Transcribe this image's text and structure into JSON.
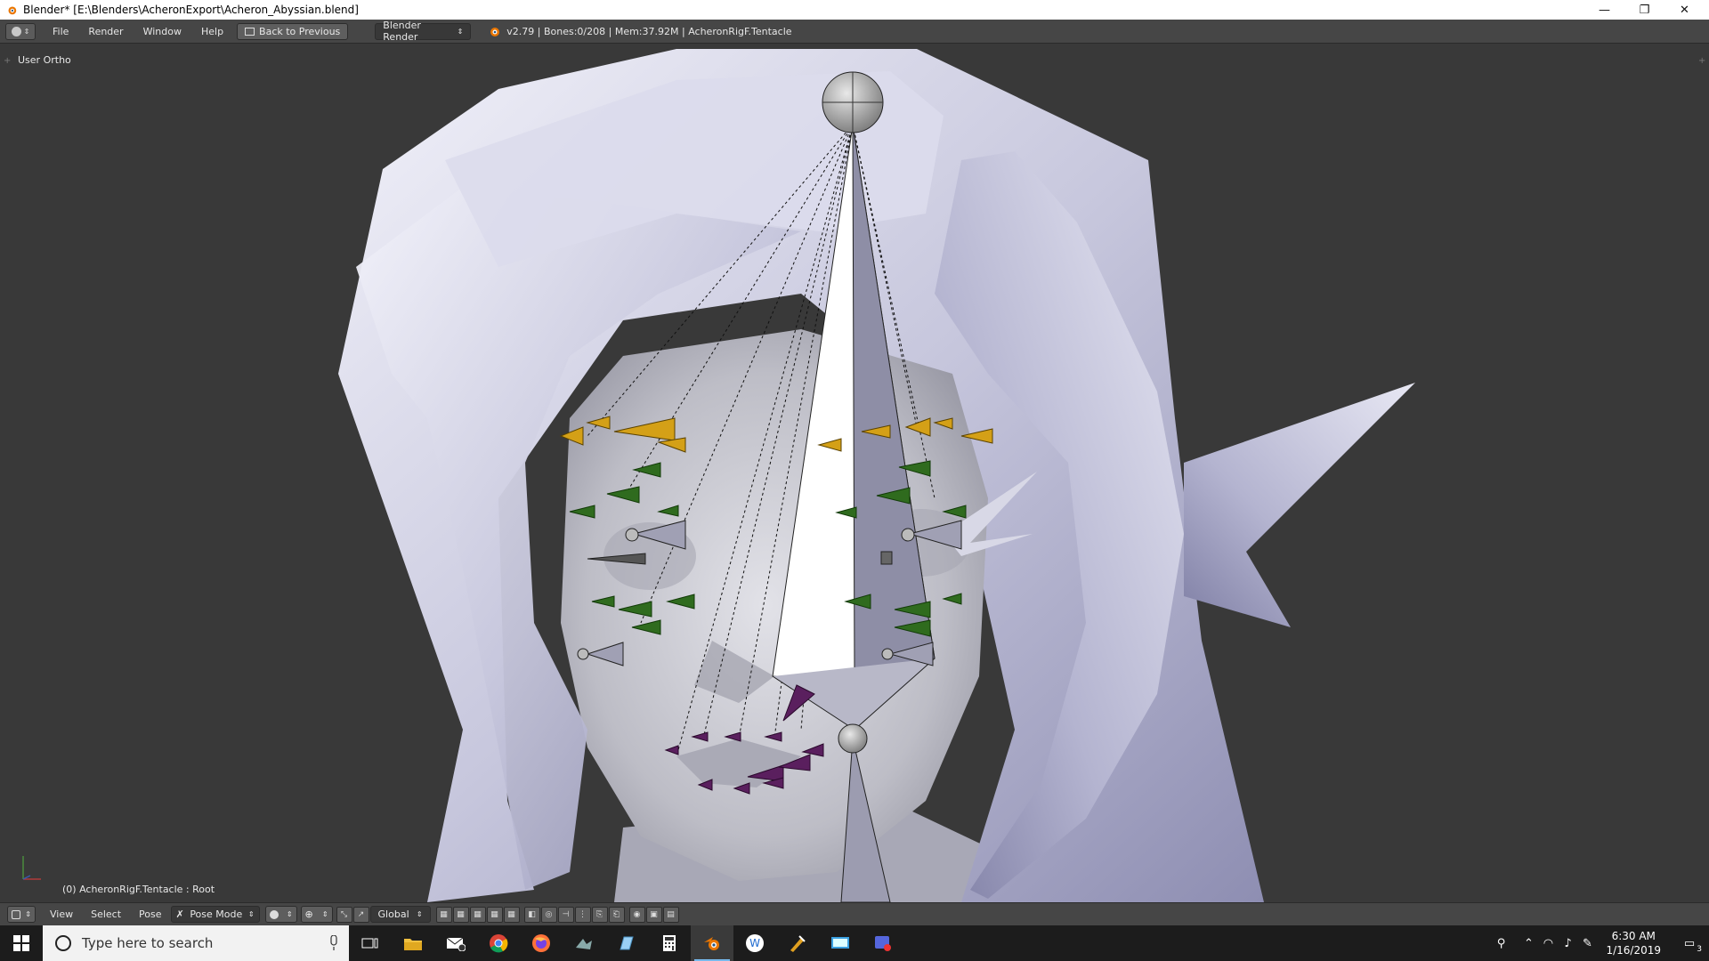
{
  "window": {
    "title": "Blender* [E:\\Blenders\\AcheronExport\\Acheron_Abyssian.blend]",
    "minimize": "—",
    "restore": "❐",
    "close": "✕"
  },
  "info_header": {
    "menus": [
      "File",
      "Render",
      "Window",
      "Help"
    ],
    "back_button": "Back to Previous",
    "render_engine": "Blender Render",
    "stats": "v2.79 | Bones:0/208 | Mem:37.92M | AcheronRigF.Tentacle"
  },
  "viewport": {
    "view_name": "User Ortho",
    "object_info": "(0) AcheronRigF.Tentacle : Root",
    "background": "#393939"
  },
  "view_header": {
    "menus": [
      "View",
      "Select",
      "Pose"
    ],
    "mode": "Pose Mode",
    "orientation": "Global"
  },
  "taskbar": {
    "search_placeholder": "Type here to search",
    "time": "6:30 AM",
    "date": "1/16/2019",
    "notifications": "3",
    "apps": [
      "task-view",
      "file-explorer",
      "mail",
      "chrome",
      "firefox",
      "app-generic",
      "app-notes",
      "calculator",
      "blender",
      "wacom",
      "app-tools",
      "app-monitor",
      "app-alert"
    ]
  },
  "colors": {
    "bone_yellow": "#d4a017",
    "bone_green": "#2f6b1e",
    "bone_purple": "#5a1f5e",
    "mesh": "#c9c9dc"
  }
}
